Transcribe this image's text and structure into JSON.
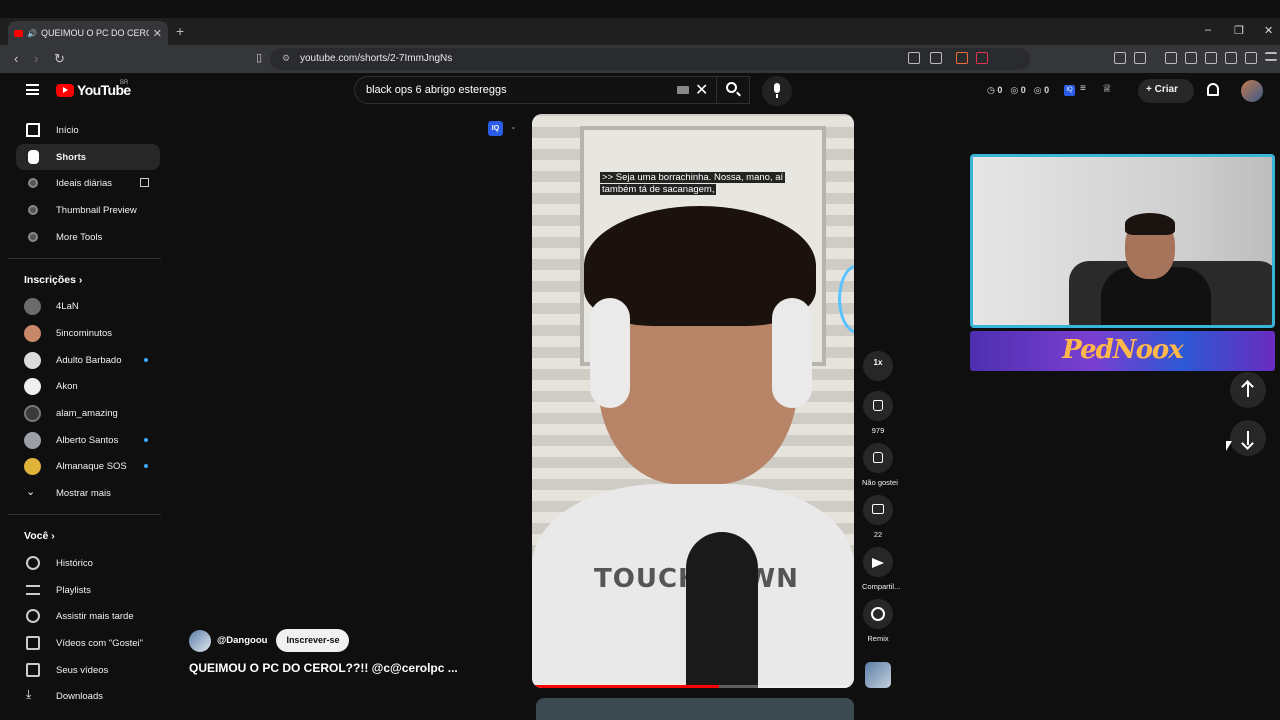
{
  "browser": {
    "tab_title": "QUEIMOU O PC DO CEROL??!! ...",
    "url": "youtube.com/shorts/2-7ImmJngNs"
  },
  "header": {
    "logo_text": "YouTube",
    "region": "BR",
    "search_value": "black ops 6 abrigo estereggs",
    "stats": [
      "0",
      "0",
      "0"
    ],
    "create_label": "Criar",
    "iq_label": "IQ"
  },
  "sidebar": {
    "main_items": [
      {
        "label": "Início",
        "icon": "home-icon"
      },
      {
        "label": "Shorts",
        "icon": "shorts-icon"
      },
      {
        "label": "Ideais diárias",
        "icon": "extension-icon"
      },
      {
        "label": "Thumbnail Preview",
        "icon": "extension-icon"
      },
      {
        "label": "More Tools",
        "icon": "extension-icon"
      }
    ],
    "subscriptions_title": "Inscrições",
    "subscriptions": [
      {
        "label": "4LaN",
        "color": "#6b6b6b"
      },
      {
        "label": "5incominutos",
        "color": "#c9876a"
      },
      {
        "label": "Adulto Barbado",
        "color": "#dcdcdc"
      },
      {
        "label": "Akon",
        "color": "#efefef"
      },
      {
        "label": "alam_amazing",
        "color": "#3a3a3a"
      },
      {
        "label": "Alberto Santos",
        "color": "#9aa0a6"
      },
      {
        "label": "Almanaque SOS",
        "color": "#e0b23a"
      }
    ],
    "show_more": "Mostrar mais",
    "you_title": "Você",
    "you_items": [
      {
        "label": "Histórico",
        "icon": "history-icon"
      },
      {
        "label": "Playlists",
        "icon": "playlists-icon"
      },
      {
        "label": "Assistir mais tarde",
        "icon": "watch-later-icon"
      },
      {
        "label": "Vídeos com \"Gostei\"",
        "icon": "like-icon"
      },
      {
        "label": "Seus vídeos",
        "icon": "your-videos-icon"
      },
      {
        "label": "Downloads",
        "icon": "downloads-icon"
      }
    ]
  },
  "short": {
    "subtitle_line1": ">> Seja uma borrachinha. Nossa, mano, aí",
    "subtitle_line2": "também tá de sacanagem,",
    "shirt_text": "TOUCHDOWN",
    "channel": "@Dangoou",
    "subscribe_label": "Inscrever-se",
    "title": "QUEIMOU O PC DO CEROL??!! @c@cerolpc ...",
    "progress_fraction": 0.58
  },
  "actions": {
    "speed": "1x",
    "likes": "979",
    "dislike_label": "Não gostei",
    "comments": "22",
    "share_label": "Compartil...",
    "remix_label": "Remix"
  },
  "overlay": {
    "banner_text": "PedNoox"
  }
}
